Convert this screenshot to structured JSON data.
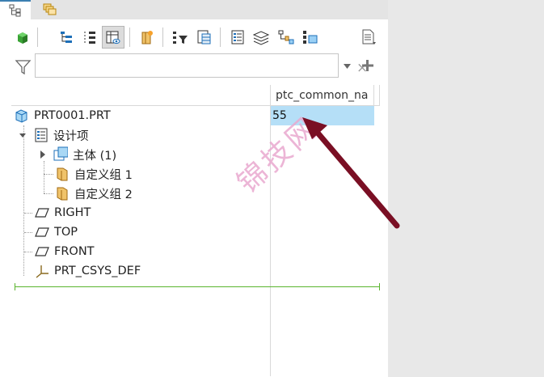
{
  "tabs": [
    {
      "icon": "model-tree-icon"
    },
    {
      "icon": "layers-stack-icon"
    }
  ],
  "filter": {
    "value": "",
    "placeholder": "",
    "clear_label": "×"
  },
  "column": {
    "header": "ptc_common_na"
  },
  "tree": {
    "root": {
      "label": "PRT0001.PRT",
      "value": "55"
    },
    "design_items": {
      "label": "设计项"
    },
    "body": {
      "label": "主体 (1)"
    },
    "group1": {
      "label": "自定义组 1"
    },
    "group2": {
      "label": "自定义组 2"
    },
    "right": {
      "label": "RIGHT"
    },
    "top": {
      "label": "TOP"
    },
    "front": {
      "label": "FRONT"
    },
    "csys": {
      "label": "PRT_CSYS_DEF"
    }
  },
  "watermark": "锦技网",
  "colors": {
    "selection": "#b5dff7",
    "arrow": "#7a0f24",
    "green_line": "#5ab42e",
    "accent": "#3c7fb1"
  }
}
